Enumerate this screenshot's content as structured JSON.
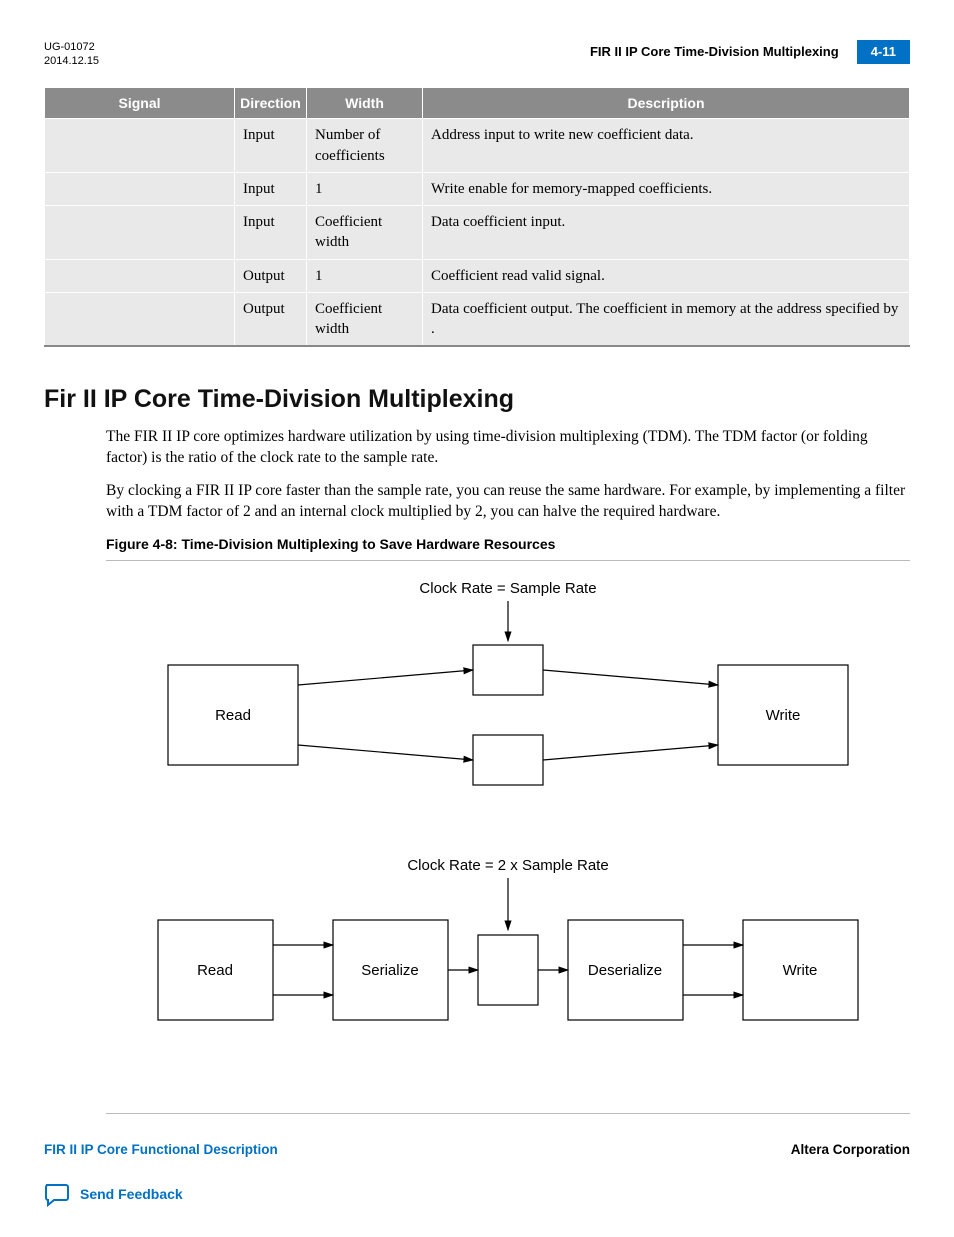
{
  "header": {
    "doc_id": "UG-01072",
    "date": "2014.12.15",
    "running_title": "FIR II IP Core Time-Division Multiplexing",
    "page_num": "4-11"
  },
  "table": {
    "headers": [
      "Signal",
      "Direction",
      "Width",
      "Description"
    ],
    "rows": [
      {
        "signal": "",
        "direction": "Input",
        "width": "Number of coefficients",
        "desc": "Address input to write new coefficient data."
      },
      {
        "signal": "",
        "direction": "Input",
        "width": "1",
        "desc": "Write enable for memory-mapped coefficients."
      },
      {
        "signal": "",
        "direction": "Input",
        "width": "Coefficient width",
        "desc": "Data coefficient input."
      },
      {
        "signal": "",
        "direction": "Output",
        "width": "1",
        "desc": "Coefficient read valid signal."
      },
      {
        "signal": "",
        "direction": "Output",
        "width": "Coefficient width",
        "desc": "Data coefficient output. The coefficient in memory at the address specified by                               ."
      }
    ]
  },
  "section": {
    "title": "Fir II IP Core Time-Division Multiplexing",
    "p1": "The FIR II IP core optimizes hardware utilization by using time-division multiplexing (TDM). The TDM factor (or folding factor) is the ratio of the clock rate to the sample rate.",
    "p2": "By clocking a FIR II IP core faster than the sample rate, you can reuse the same hardware. For example, by implementing a filter with a TDM factor of 2 and an internal clock multiplied by 2, you can halve the required hardware."
  },
  "figure": {
    "caption": "Figure 4-8: Time-Division Multiplexing to Save Hardware Resources",
    "labels": {
      "top": "Clock Rate = Sample Rate",
      "bot": "Clock Rate = 2 x Sample Rate",
      "read": "Read",
      "write": "Write",
      "serialize": "Serialize",
      "deserialize": "Deserialize"
    }
  },
  "footer": {
    "left_link": "FIR II IP Core Functional Description",
    "right_text": "Altera Corporation",
    "feedback": "Send Feedback"
  }
}
